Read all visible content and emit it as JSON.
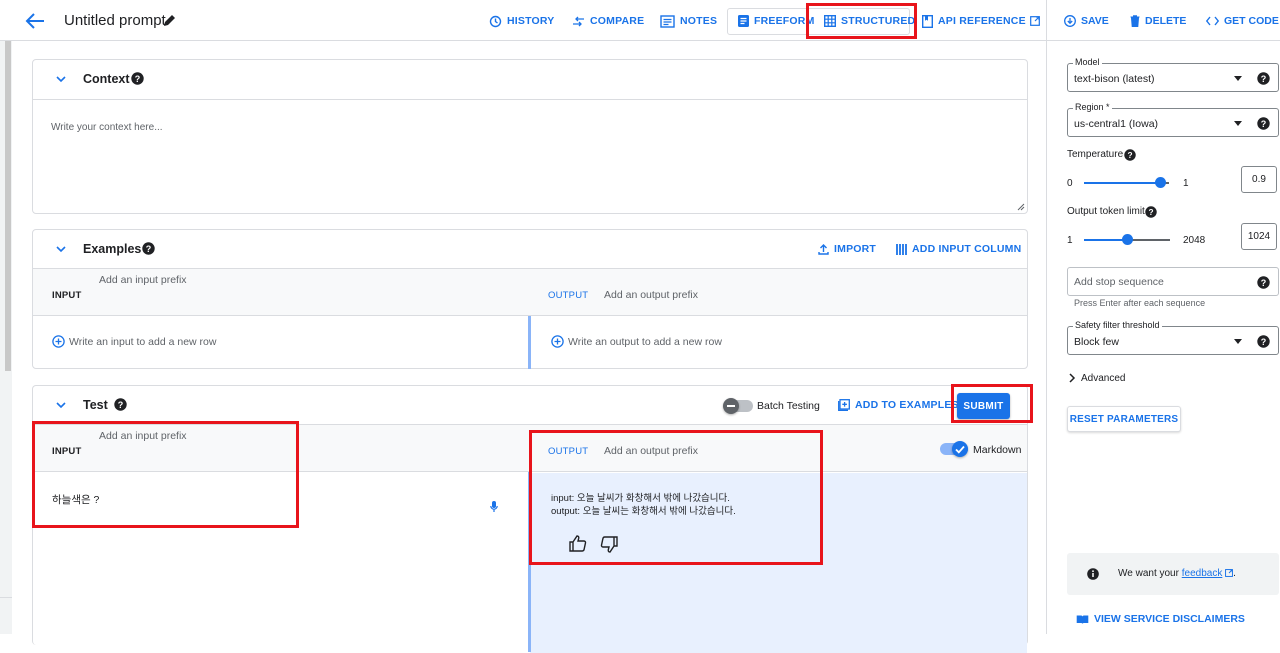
{
  "header": {
    "title": "Untitled prompt",
    "nav": {
      "history": "HISTORY",
      "compare": "COMPARE",
      "notes": "NOTES",
      "freeform": "FREEFORM",
      "structured": "STRUCTURED",
      "api_reference": "API REFERENCE"
    }
  },
  "context": {
    "title": "Context",
    "placeholder": "Write your context here..."
  },
  "examples": {
    "title": "Examples",
    "import_label": "IMPORT",
    "add_column_label": "ADD INPUT COLUMN",
    "input_label": "INPUT",
    "input_prefix_placeholder": "Add an input prefix",
    "output_label": "OUTPUT",
    "output_prefix_placeholder": "Add an output prefix",
    "add_input_row": "Write an input to add a new row",
    "add_output_row": "Write an output to add a new row"
  },
  "test": {
    "title": "Test",
    "batch_testing_label": "Batch Testing",
    "add_to_examples_label": "ADD TO EXAMPLES",
    "submit_label": "SUBMIT",
    "input_label": "INPUT",
    "input_prefix_placeholder": "Add an input prefix",
    "output_label": "OUTPUT",
    "output_prefix_placeholder": "Add an output prefix",
    "markdown_label": "Markdown",
    "markdown_enabled": true,
    "batch_testing_enabled": false,
    "input_value": "하늘색은 ?",
    "output_line1": "input: 오늘 날씨가 화창해서 밖에 나갔습니다.",
    "output_line2": "output: 오늘 날씨는 화창해서 밖에 나갔습니다."
  },
  "side_panel": {
    "actions": {
      "save": "SAVE",
      "delete": "DELETE",
      "get_code": "GET CODE"
    },
    "model": {
      "label": "Model",
      "value": "text-bison (latest)"
    },
    "region": {
      "label": "Region *",
      "value": "us-central1 (Iowa)"
    },
    "temperature": {
      "label": "Temperature",
      "min": "0",
      "max": "1",
      "value": "0.9",
      "fraction": 0.9
    },
    "token_limit": {
      "label": "Output token limit",
      "min": "1",
      "max": "2048",
      "value": "1024",
      "fraction": 0.5
    },
    "stop_sequence": {
      "placeholder": "Add stop sequence",
      "hint": "Press Enter after each sequence"
    },
    "safety": {
      "label": "Safety filter threshold",
      "value": "Block few"
    },
    "advanced_label": "Advanced",
    "reset_label": "RESET PARAMETERS",
    "feedback": {
      "text": "We want your ",
      "link": "feedback",
      "suffix": "."
    },
    "disclaimers_label": "VIEW SERVICE DISCLAIMERS"
  },
  "colors": {
    "accent": "#1a73e8",
    "highlight": "#e8141b",
    "output_bg": "#e8f0fe"
  }
}
